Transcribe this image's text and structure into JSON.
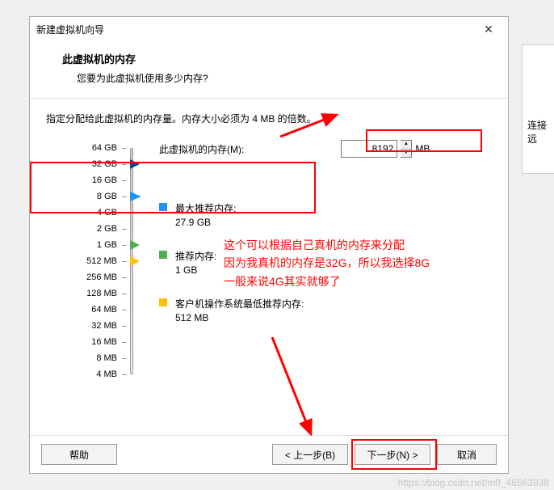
{
  "dialog": {
    "title": "新建虚拟机向导",
    "header_title": "此虚拟机的内存",
    "header_sub": "您要为此虚拟机使用多少内存?",
    "instruction": "指定分配给此虚拟机的内存量。内存大小必须为 4 MB 的倍数。",
    "mem_label": "此虚拟机的内存(M):",
    "mem_value": "8192",
    "mem_unit": "MB"
  },
  "scale": [
    "64 GB",
    "32 GB",
    "16 GB",
    "8 GB",
    "4 GB",
    "2 GB",
    "1 GB",
    "512 MB",
    "256 MB",
    "128 MB",
    "64 MB",
    "32 MB",
    "16 MB",
    "8 MB",
    "4 MB"
  ],
  "recommend": {
    "max_label": "最大推荐内存:",
    "max_val": "27.9 GB",
    "rec_label": "推荐内存:",
    "rec_val": "1 GB",
    "min_label": "客户机操作系统最低推荐内存:",
    "min_val": "512 MB"
  },
  "annotation": {
    "line1": "这个可以根据自己真机的内存来分配",
    "line2": "因为我真机的内存是32G，所以我选择8G",
    "line3": "一般来说4G其实就够了"
  },
  "footer": {
    "help": "帮助",
    "back": "< 上一步(B)",
    "next": "下一步(N) >",
    "cancel": "取消"
  },
  "side_text": "连接远",
  "watermark": "https://blog.csdn.net/m0_46563938"
}
